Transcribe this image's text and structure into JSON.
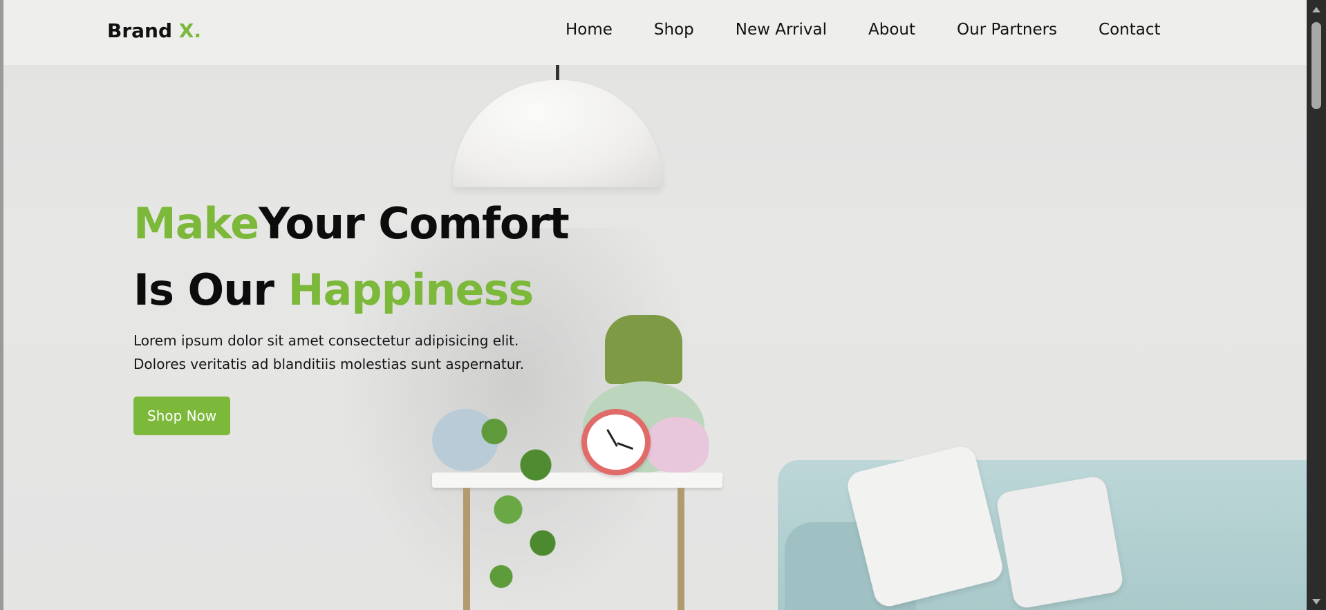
{
  "header": {
    "brand": {
      "name": "Brand",
      "accent": "X."
    },
    "nav": [
      "Home",
      "Shop",
      "New Arrival",
      "About",
      "Our Partners",
      "Contact"
    ]
  },
  "hero": {
    "line1_green": "Make",
    "line1_rest": "Your Comfort",
    "line2_black": "Is Our ",
    "line2_green": "Happiness",
    "desc_line1": "Lorem ipsum dolor sit amet consectetur adipisicing elit.",
    "desc_line2": "Dolores veritatis ad blanditiis molestias sunt aspernatur.",
    "cta": "Shop Now"
  },
  "colors": {
    "accent": "#7cb83a",
    "header_bg": "#eeeeec",
    "page_bg": "#e4e4e3",
    "text": "#0c0c0c"
  },
  "icons": [
    "scroll-up-arrow-icon",
    "scroll-down-arrow-icon"
  ]
}
